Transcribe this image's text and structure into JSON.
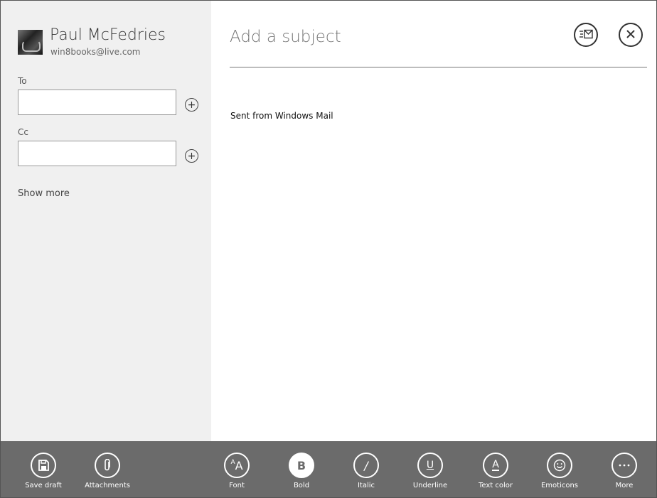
{
  "account": {
    "name": "Paul McFedries",
    "email": "win8books@live.com"
  },
  "recipients": {
    "to_label": "To",
    "to_value": "",
    "cc_label": "Cc",
    "cc_value": "",
    "add_glyph": "+",
    "show_more": "Show more"
  },
  "message": {
    "subject_placeholder": "Add a subject",
    "subject_value": "",
    "body": "Sent from Windows Mail"
  },
  "header_actions": {
    "send_icon": "send-mail-icon",
    "close_icon": "close-icon"
  },
  "app_bar": {
    "items": [
      {
        "label": "Save draft",
        "icon": "save-icon"
      },
      {
        "label": "Attachments",
        "icon": "paperclip-icon"
      },
      {
        "label": "Font",
        "icon": "font-icon"
      },
      {
        "label": "Bold",
        "icon": "bold-icon"
      },
      {
        "label": "Italic",
        "icon": "italic-icon"
      },
      {
        "label": "Underline",
        "icon": "underline-icon"
      },
      {
        "label": "Text color",
        "icon": "text-color-icon"
      },
      {
        "label": "Emoticons",
        "icon": "emoticon-icon"
      },
      {
        "label": "More",
        "icon": "more-icon"
      }
    ]
  },
  "colors": {
    "app_bar_bg": "#6b6b6b",
    "left_pane_bg": "#f0f0f0"
  }
}
